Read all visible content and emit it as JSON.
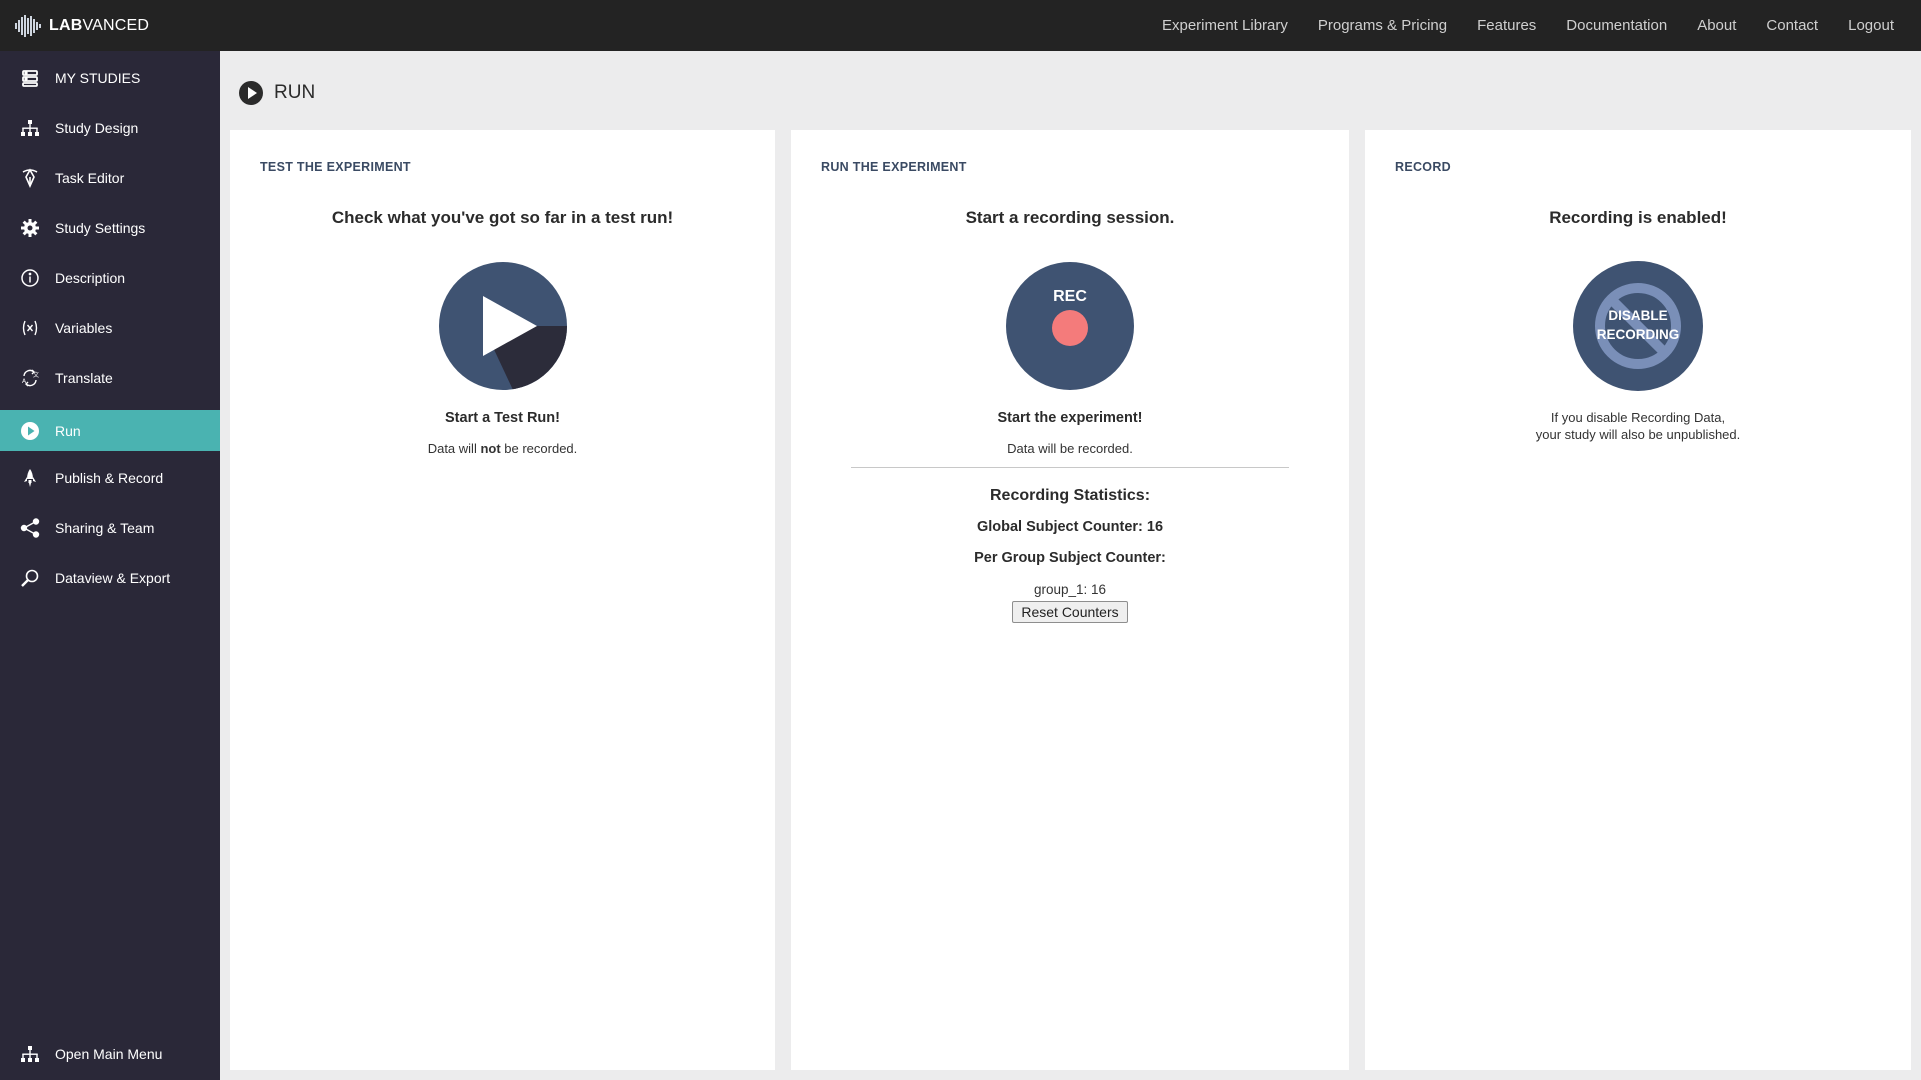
{
  "app": {
    "logo_bold": "LAB",
    "logo_rest": "VANCED"
  },
  "topnav": [
    {
      "label": "Experiment Library"
    },
    {
      "label": "Programs & Pricing"
    },
    {
      "label": "Features"
    },
    {
      "label": "Documentation"
    },
    {
      "label": "About"
    },
    {
      "label": "Contact"
    },
    {
      "label": "Logout"
    }
  ],
  "sidebar": {
    "items": [
      {
        "label": "MY STUDIES",
        "icon": "stack-icon"
      },
      {
        "label": "Study Design",
        "icon": "hierarchy-icon"
      },
      {
        "label": "Task Editor",
        "icon": "pen-icon"
      },
      {
        "label": "Study Settings",
        "icon": "gear-icon"
      },
      {
        "label": "Description",
        "icon": "info-icon"
      },
      {
        "label": "Variables",
        "icon": "variable-icon"
      },
      {
        "label": "Translate",
        "icon": "translate-icon"
      },
      {
        "label": "Run",
        "icon": "play-icon",
        "active": true
      },
      {
        "label": "Publish & Record",
        "icon": "rocket-icon"
      },
      {
        "label": "Sharing & Team",
        "icon": "share-icon"
      },
      {
        "label": "Dataview & Export",
        "icon": "magnifier-icon"
      }
    ],
    "footer": {
      "label": "Open Main Menu",
      "icon": "hierarchy-icon"
    },
    "active_color": "#4ab3b1"
  },
  "page": {
    "title": "RUN"
  },
  "panels": {
    "test": {
      "heading": "TEST THE EXPERIMENT",
      "subtitle": "Check what you've got so far in a test run!",
      "caption": "Start a Test Run!",
      "note_pre": "Data will ",
      "note_bold": "not",
      "note_post": " be recorded."
    },
    "run": {
      "heading": "RUN THE EXPERIMENT",
      "subtitle": "Start a recording session.",
      "rec_label": "REC",
      "caption": "Start the experiment!",
      "note": "Data will be recorded.",
      "stats_title": "Recording Statistics:",
      "global_counter": "Global Subject Counter: 16",
      "per_group_label": "Per Group Subject Counter:",
      "group_counter": "group_1: 16",
      "reset_label": "Reset Counters"
    },
    "record": {
      "heading": "RECORD",
      "subtitle": "Recording is enabled!",
      "disable_line1": "DISABLE",
      "disable_line2": "RECORDING",
      "note_line1": "If you disable Recording Data,",
      "note_line2": "your study will also be unpublished."
    }
  },
  "colors": {
    "circle": "#3f5372",
    "rec_dot": "#f47b7b",
    "topbar": "#232323",
    "sidebar": "#2a2838"
  }
}
